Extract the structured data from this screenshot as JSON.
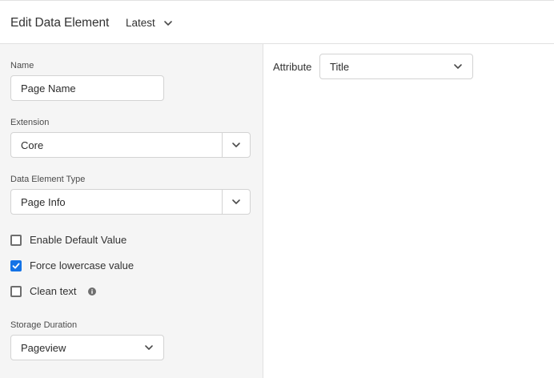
{
  "header": {
    "title": "Edit Data Element",
    "version_label": "Latest"
  },
  "form": {
    "name": {
      "label": "Name",
      "value": "Page Name"
    },
    "extension": {
      "label": "Extension",
      "value": "Core"
    },
    "data_element_type": {
      "label": "Data Element Type",
      "value": "Page Info"
    },
    "options": [
      {
        "label": "Enable Default Value",
        "checked": false
      },
      {
        "label": "Force lowercase value",
        "checked": true
      },
      {
        "label": "Clean text",
        "checked": false
      }
    ],
    "storage_duration": {
      "label": "Storage Duration",
      "value": "Pageview"
    }
  },
  "settings": {
    "attribute": {
      "label": "Attribute",
      "value": "Title"
    }
  },
  "colors": {
    "accent": "#1473e6",
    "panel_bg": "#f5f5f5"
  },
  "icons": {
    "version_chevron": "chevron-down-icon",
    "info": "info-icon",
    "check": "checkmark-icon"
  }
}
